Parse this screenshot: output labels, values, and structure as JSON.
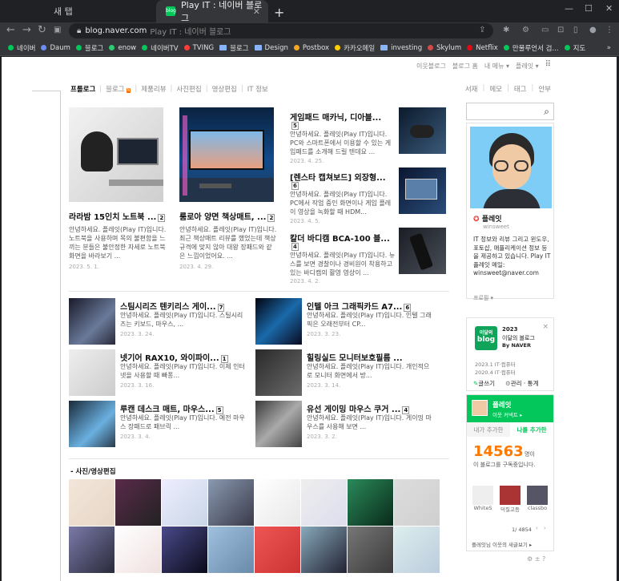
{
  "browser": {
    "tabs": [
      {
        "label": "새 탭"
      },
      {
        "label": "Play IT : 네이버 블로그",
        "favicon": "blog"
      }
    ],
    "new_tab": "+",
    "url_host": "blog.naver.com",
    "url_title": "Play IT : 네이버 블로그",
    "bookmarks": [
      {
        "label": "네이버",
        "color": "#03c75a",
        "type": "dot"
      },
      {
        "label": "Daum",
        "color": "#6d8cf5",
        "type": "dot"
      },
      {
        "label": "블로그",
        "color": "#03c75a",
        "type": "dot"
      },
      {
        "label": "enow",
        "color": "#2ecc71",
        "type": "dot"
      },
      {
        "label": "네이버TV",
        "color": "#03c75a",
        "type": "dot"
      },
      {
        "label": "TVING",
        "color": "#ff3b3b",
        "type": "dot"
      },
      {
        "label": "블로그",
        "type": "folder"
      },
      {
        "label": "Design",
        "type": "folder"
      },
      {
        "label": "Postbox",
        "color": "#f5a623",
        "type": "dot"
      },
      {
        "label": "카카오메일",
        "color": "#ffcd00",
        "type": "dot"
      },
      {
        "label": "investing",
        "type": "folder"
      },
      {
        "label": "Skylum",
        "color": "#d04a4a",
        "type": "dot"
      },
      {
        "label": "Netflix",
        "color": "#e50914",
        "type": "dot"
      },
      {
        "label": "만물루언서 검...",
        "color": "#03c75a",
        "type": "dot"
      },
      {
        "label": "지도",
        "color": "#03c75a",
        "type": "dot"
      }
    ]
  },
  "gnb": {
    "items": [
      "이웃블로그",
      "블로그 홈",
      "내 메뉴 ▾",
      "플레잇 ▾"
    ]
  },
  "menu": {
    "items": [
      "프롤로그",
      "블로그",
      "제품리뷰",
      "사진편집",
      "영상편집",
      "IT 정보"
    ],
    "right": [
      "서재",
      "메모",
      "태그",
      "안부"
    ],
    "new_badge": "N"
  },
  "featured": [
    {
      "title": "라라밤 15인치 노트북 ...",
      "count": "2",
      "snippet": "안녕하세요. 플레잇(Play IT)입니다. 노트북을 사용하며 목의 불편함을 느끼는 분들은 불안정한 자세로 노트북 화면을 바라보기 ...",
      "date": "2023. 5. 1."
    },
    {
      "title": "룸로아 양면 책상매트, ...",
      "count": "2",
      "snippet": "안녕하세요. 플레잇(Play IT)입니다. 최근 책상매트 리뷰를 했었는데 책상 규격에 맞지 않아 대왕 장패드와 같은 느낌이었어요. ...",
      "date": "2023. 4. 29."
    }
  ],
  "side_posts": [
    {
      "title": "게임패드 매카닉, 디아블...",
      "count": "5",
      "snippet": "안녕하세요. 플레잇(Play IT)입니다. PC와 스마트폰에서 이용할 수 있는 게임패드를 소개해 드릴 텐데요 ...",
      "date": "2023. 4. 25."
    },
    {
      "title": "[렌스타 캡쳐보드] 외장형...",
      "count": "6",
      "snippet": "안녕하세요. 플레잇(Play IT)입니다. PC에서 작업 중인 화면이나 게임 플레이 영상을 녹화할 때 HDM...",
      "date": "2023. 4. 5."
    },
    {
      "title": "칼더 바디캠 BCA-100 블...",
      "count": "4",
      "snippet": "안녕하세요. 플레잇(Play IT)입니다. 뉴스를 보면 경찰이나 경비원이 착용하고 있는 바디캠의 활영 영상이 ...",
      "date": "2023. 4. 2."
    }
  ],
  "list_posts": [
    {
      "title": "스팀시리즈 텐키리스 게이...",
      "count": "7",
      "snippet": "안녕하세요. 플레잇(Play IT)입니다. 스틸시리즈는 키보드, 마우스, ...",
      "date": "2023. 3. 24."
    },
    {
      "title": "인텔 아크 그래픽카드 A7...",
      "count": "6",
      "snippet": "안녕하세요. 플레잇(Play IT)입니다. 인텔 그래픽은 오래전부터 CP...",
      "date": "2023. 3. 23."
    },
    {
      "title": "넷기어 RAX10, 와이파이...",
      "count": "1",
      "snippet": "안녕하세요. 플레잇(Play IT)입니다. 이제 인터넷을 사용할 때 빠퐁...",
      "date": "2023. 3. 16."
    },
    {
      "title": "힐링실드 모니터보호필름 ...",
      "count": "",
      "snippet": "안녕하세요. 플레잇(Play IT)입니다. 개인적으로 모니터 화면에서 방...",
      "date": "2023. 3. 14."
    },
    {
      "title": "루캔 데스크 매트, 마우스...",
      "count": "5",
      "snippet": "안녕하세요. 플레잇(Play IT)입니다. 예전 마우스 장패드로 패브릭 ...",
      "date": "2023. 3. 4."
    },
    {
      "title": "유선 게이밍 마우스 쿠거 ...",
      "count": "4",
      "snippet": "안녕하세요. 플레잇(Play IT)입니다. 게이밍 마우스를 사용해 보면 ...",
      "date": "2023. 3. 2."
    }
  ],
  "photo_section": {
    "title": "- 사진/영상편집"
  },
  "profile": {
    "nickname": "플레잇",
    "id": "winsweet",
    "bio": "IT 정보와 리뷰 그리고 윈도우, 포토샵, 애플리케이션 정보 등을 제공하고 있습니다. Play IT 플레잇 메일: winsweet@naver.com",
    "profile_link": "프로필 ▾"
  },
  "award": {
    "badge_top": "이달의",
    "badge_main": "blog",
    "year": "2023",
    "line1": "이달의 블로그",
    "line2": "By NAVER",
    "hist1": "2023.1  IT·컴퓨터",
    "hist2": "2020.4  IT·컴퓨터",
    "write": "글쓰기",
    "manage": "관리 · 통계",
    "close": "×"
  },
  "buddy": {
    "name": "플레잇",
    "sub": "이웃 커넥트 ▸",
    "tab1": "내가 추가한",
    "tab2": "나를 추가한",
    "count": "14563",
    "unit": "명이",
    "desc": "이 블로그를 구독중입니다.",
    "friends": [
      "WhiteS",
      "덕질고등",
      "classbo"
    ],
    "pager": "1/ 4854",
    "footer": "플레잇님 이웃의 새글보기 ▸"
  },
  "footer": {
    "icons": "⚙ ± ?"
  }
}
